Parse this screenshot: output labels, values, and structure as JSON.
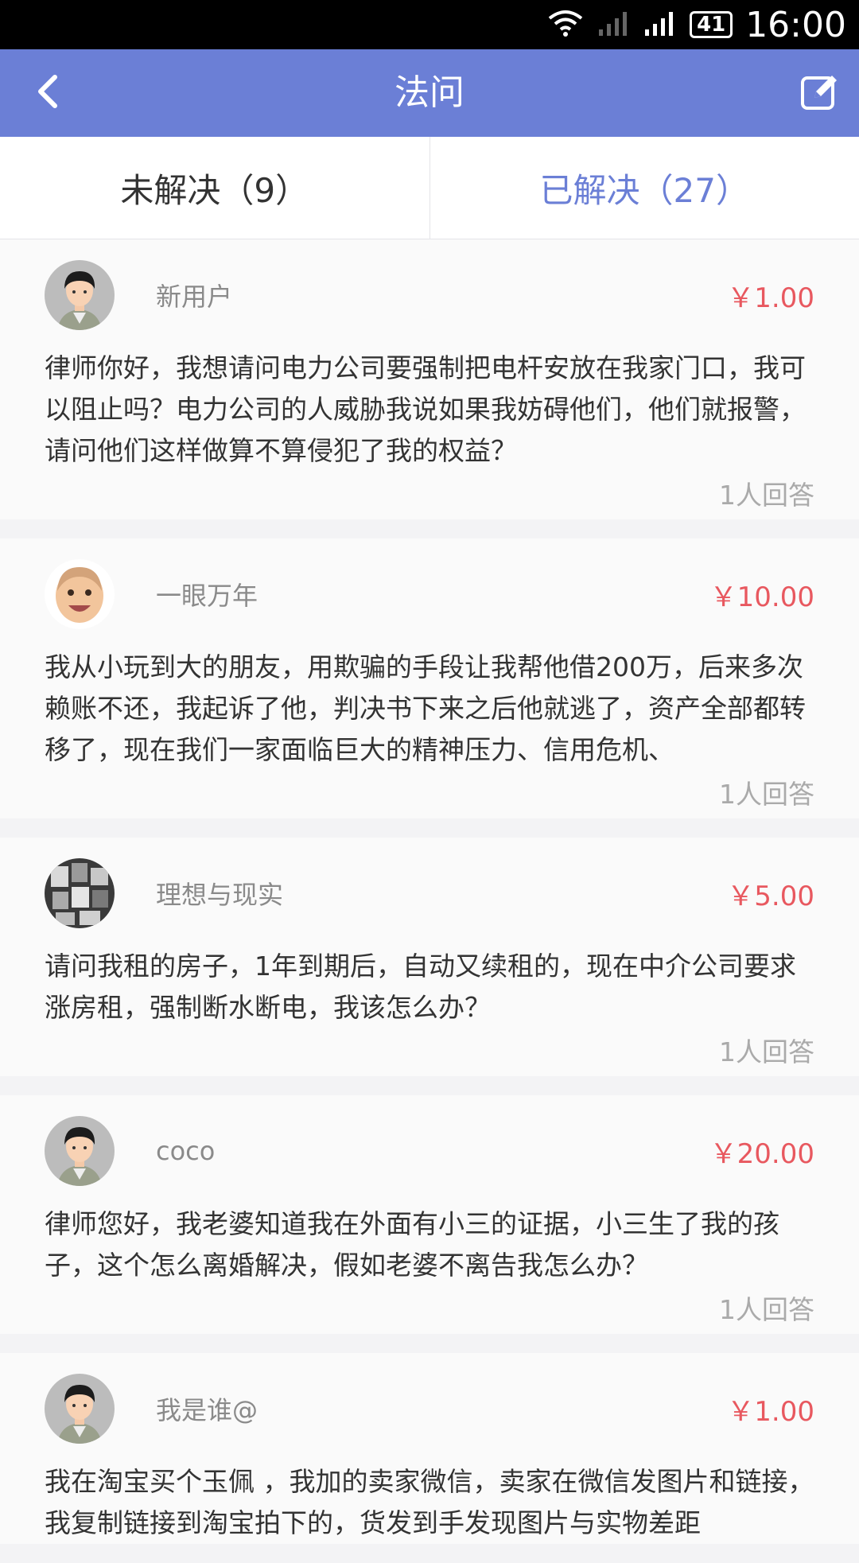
{
  "status_bar": {
    "battery": "41",
    "time": "16:00",
    "icons": [
      "wifi-icon",
      "signal-weak-icon",
      "signal-icon",
      "battery-icon"
    ]
  },
  "header": {
    "title": "法问",
    "back_icon": "chevron-left-icon",
    "edit_icon": "edit-icon",
    "background": "#6b7fd6"
  },
  "tabs": [
    {
      "label": "未解决（9）",
      "active": false
    },
    {
      "label": "已解决（27）",
      "active": true
    }
  ],
  "colors": {
    "accent": "#6b7fd6",
    "price": "#e8585f"
  },
  "questions": [
    {
      "user": "新用户",
      "avatar": "default-male-avatar",
      "price": "￥1.00",
      "text": "律师你好，我想请问电力公司要强制把电杆安放在我家门口，我可以阻止吗？电力公司的人威胁我说如果我妨碍他们，他们就报警，请问他们这样做算不算侵犯了我的权益？",
      "answers": "1人回答"
    },
    {
      "user": "一眼万年",
      "avatar": "baby-photo-avatar",
      "price": "￥10.00",
      "text": "我从小玩到大的朋友，用欺骗的手段让我帮他借200万，后来多次赖账不还，我起诉了他，判决书下来之后他就逃了，资产全部都转移了，现在我们一家面临巨大的精神压力、信用危机、",
      "answers": "1人回答"
    },
    {
      "user": "理想与现实",
      "avatar": "photo-collage-avatar",
      "price": "￥5.00",
      "text": "请问我租的房子，1年到期后，自动又续租的，现在中介公司要求涨房租，强制断水断电，我该怎么办？",
      "answers": "1人回答"
    },
    {
      "user": "coco",
      "avatar": "default-male-avatar",
      "price": "￥20.00",
      "text": "律师您好，我老婆知道我在外面有小三的证据，小三生了我的孩子，这个怎么离婚解决，假如老婆不离告我怎么办？",
      "answers": "1人回答"
    },
    {
      "user": "我是谁@",
      "avatar": "default-male-avatar",
      "price": "￥1.00",
      "text": "我在淘宝买个玉佩 ，我加的卖家微信，卖家在微信发图片和链接，我复制链接到淘宝拍下的，货发到手发现图片与实物差距",
      "answers": ""
    }
  ]
}
